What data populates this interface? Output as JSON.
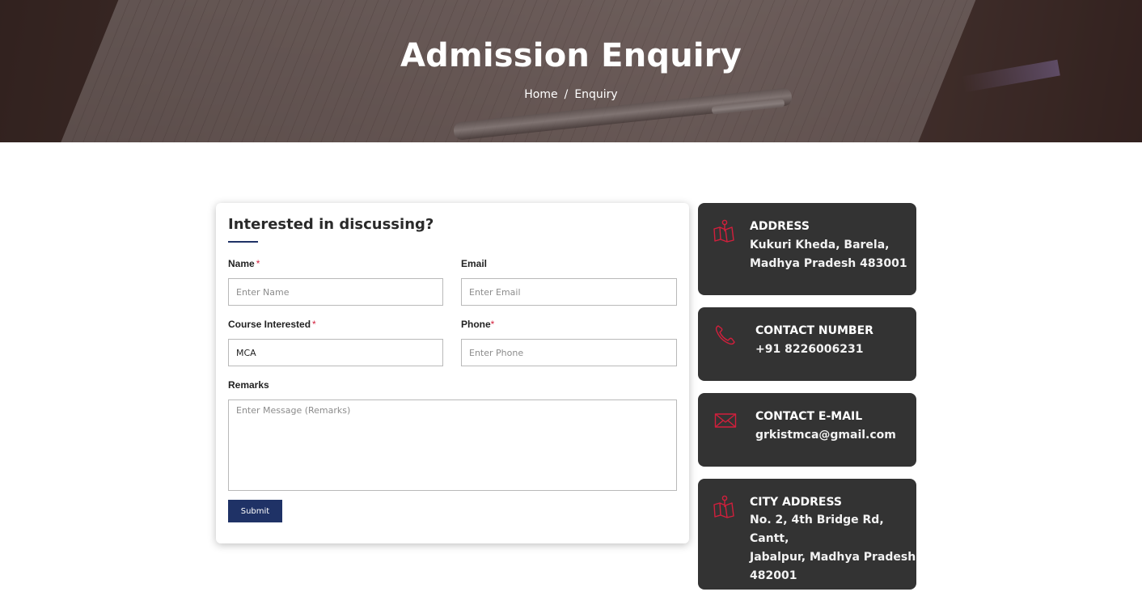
{
  "hero": {
    "title": "Admission Enquiry",
    "breadcrumb": {
      "home": "Home",
      "separator": "/",
      "current": "Enquiry"
    }
  },
  "form": {
    "heading": "Interested in discussing?",
    "required_mark": "*",
    "name": {
      "label": "Name",
      "placeholder": "Enter Name",
      "value": ""
    },
    "email": {
      "label": "Email",
      "placeholder": "Enter Email",
      "value": ""
    },
    "course": {
      "label": "Course Interested",
      "value": "MCA"
    },
    "phone": {
      "label": "Phone",
      "placeholder": "Enter Phone",
      "value": ""
    },
    "remarks": {
      "label": "Remarks",
      "placeholder": "Enter Message (Remarks)"
    },
    "submit_label": "Submit"
  },
  "contact": {
    "address": {
      "title": "ADDRESS",
      "lines": [
        "Kukuri Kheda, Barela,",
        "Madhya Pradesh 483001"
      ],
      "icon": "map-icon"
    },
    "phone": {
      "title": "CONTACT NUMBER",
      "value": "+91 8226006231",
      "icon": "phone-icon"
    },
    "email": {
      "title": "CONTACT E-MAIL",
      "value": "grkistmca@gmail.com",
      "icon": "envelope-icon"
    },
    "city_address": {
      "title": "CITY ADDRESS",
      "lines": [
        "No. 2, 4th Bridge Rd, Cantt,",
        "Jabalpur, Madhya Pradesh",
        "482001"
      ],
      "icon": "map-icon"
    }
  },
  "colors": {
    "brand_navy": "#1f3266",
    "card_dark": "#333333",
    "icon_red": "#d21f3c",
    "required_red": "#d21f3c"
  }
}
